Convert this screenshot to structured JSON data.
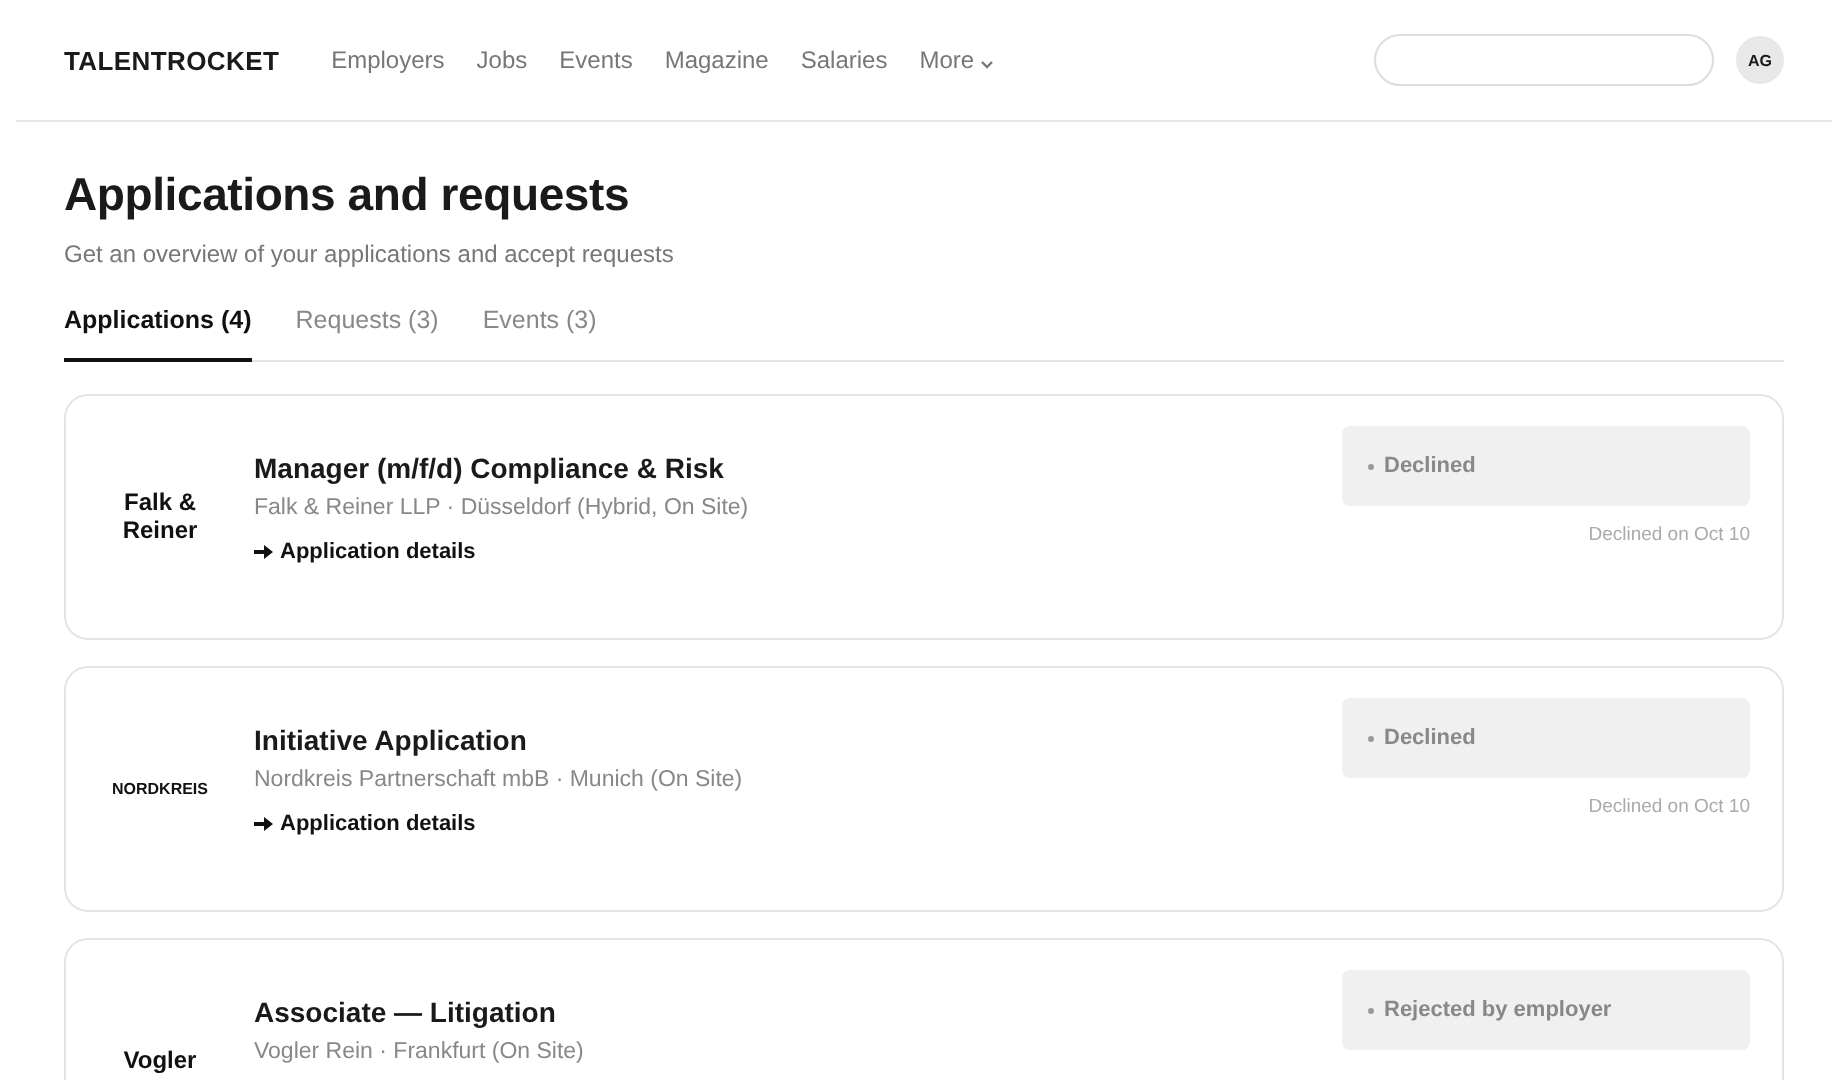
{
  "header": {
    "logo": "TALENTROCKET",
    "nav": [
      {
        "label": "Employers",
        "has_menu": false
      },
      {
        "label": "Jobs",
        "has_menu": false
      },
      {
        "label": "Events",
        "has_menu": false
      },
      {
        "label": "Magazine",
        "has_menu": false
      },
      {
        "label": "Salaries",
        "has_menu": false
      },
      {
        "label": "More",
        "has_menu": true
      }
    ],
    "avatar": "AG"
  },
  "page": {
    "title": "Applications and requests",
    "subtitle": "Get an overview of your applications and accept requests"
  },
  "tabs": [
    {
      "label": "Applications (4)",
      "selected": true
    },
    {
      "label": "Requests (3)",
      "selected": false
    },
    {
      "label": "Events (3)",
      "selected": false
    }
  ],
  "applications": [
    {
      "logo": "Falk & Reiner",
      "kind": "words",
      "title": "Manager (m/f/d) Compliance & Risk",
      "company": "Falk & Reiner LLP · Düsseldorf (Hybrid, On Site)",
      "link": "Application details",
      "status": "Declined",
      "date": "Declined on Oct 10"
    },
    {
      "logo": "NORDKREIS",
      "kind": "caps",
      "title": "Initiative Application",
      "company": "Nordkreis Partnerschaft mbB · Munich (On Site)",
      "link": "Application details",
      "status": "Declined",
      "date": "Declined on Oct 10"
    },
    {
      "logo": "Vogler",
      "kind": "words",
      "title": "Associate — Litigation",
      "company": "Vogler Rein · Frankfurt (On Site)",
      "status": "Rejected by employer"
    }
  ]
}
